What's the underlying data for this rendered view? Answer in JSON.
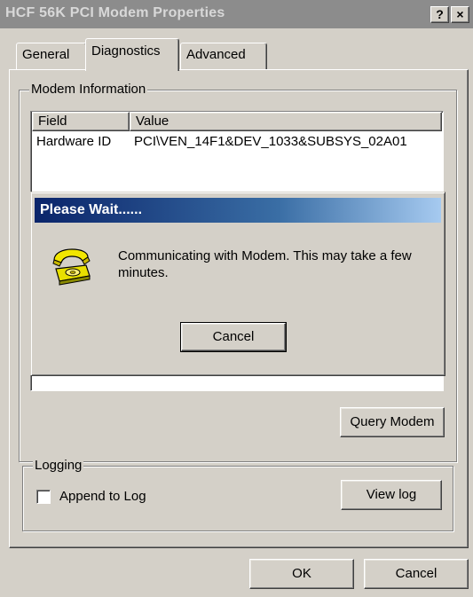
{
  "window": {
    "title": "HCF 56K PCI Modem Properties",
    "help_label": "?",
    "close_label": "×"
  },
  "tabs": [
    {
      "label": "General",
      "active": false
    },
    {
      "label": "Diagnostics",
      "active": true
    },
    {
      "label": "Advanced",
      "active": false
    }
  ],
  "modem_info": {
    "group_label": "Modem Information",
    "columns": [
      "Field",
      "Value"
    ],
    "rows": [
      {
        "field": "Hardware ID",
        "value": "PCI\\VEN_14F1&DEV_1033&SUBSYS_02A01"
      }
    ]
  },
  "query_modem_label": "Query Modem",
  "logging": {
    "group_label": "Logging",
    "append_label": "Append to Log",
    "append_checked": false,
    "view_log_label": "View log"
  },
  "footer": {
    "ok_label": "OK",
    "cancel_label": "Cancel"
  },
  "wait_dialog": {
    "title": "Please Wait......",
    "message": "Communicating with Modem. This may take a few minutes.",
    "cancel_label": "Cancel",
    "icon": "telephone-icon"
  }
}
